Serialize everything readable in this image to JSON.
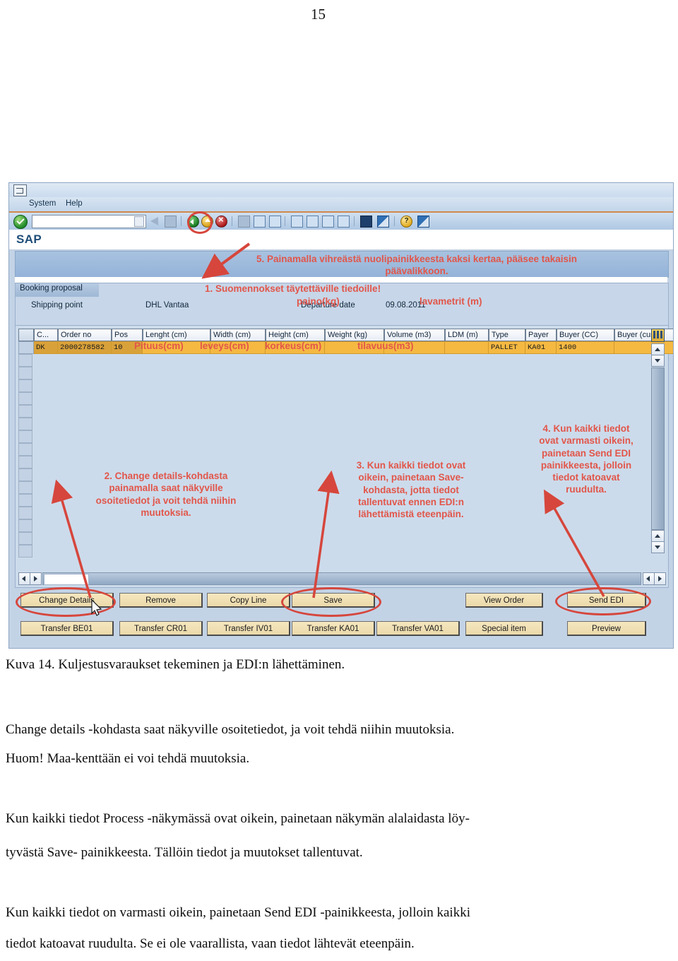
{
  "document": {
    "page_number": "15",
    "caption": "Kuva 14. Kuljestusvaraukset tekeminen ja EDI:n lähettäminen.",
    "paragraphs": [
      "Change details -kohdasta saat näkyville osoitetiedot, ja voit tehdä niihin muutoksia.",
      "Huom! Maa-kenttään ei voi tehdä muutoksia.",
      "Kun kaikki tiedot Process -näkymässä ovat oikein, painetaan näkymän alalaidasta löy-",
      "tyvästä Save- painikkeesta. Tällöin tiedot ja muutokset tallentuvat.",
      "Kun kaikki tiedot on varmasti oikein, painetaan Send EDI -painikkeesta, jolloin kaikki",
      "tiedot katoavat ruudulta. Se ei ole vaarallista, vaan tiedot lähtevät eteenpäin."
    ]
  },
  "sap": {
    "menubar": {
      "system": "System",
      "help": "Help"
    },
    "command_field": {
      "value": "",
      "placeholder": ""
    },
    "app_title": "SAP",
    "group": {
      "tab_label": "Booking proposal",
      "fields": [
        {
          "label": "Shipping point",
          "value": "DHL Vantaa"
        },
        {
          "label": "Departure date",
          "value": "09.08.2011"
        }
      ]
    },
    "grid": {
      "columns": [
        "C...",
        "Order no",
        "Pos",
        "Lenght (cm)",
        "Width (cm)",
        "Height (cm)",
        "Weight (kg)",
        "Volume (m3)",
        "LDM (m)",
        "Type",
        "Payer",
        "Buyer (CC)",
        "Buyer (cust)"
      ],
      "rows": [
        {
          "country": "DK",
          "order_no": "2000278582",
          "pos": "10",
          "length": "",
          "width": "",
          "height": "",
          "weight": "",
          "volume": "",
          "ldm": "",
          "type": "PALLET",
          "payer": "KA01",
          "buyer_cc": "1400",
          "buyer_cust": ""
        }
      ]
    },
    "buttons_row1": [
      "Change Details",
      "Remove",
      "Copy Line",
      "Save",
      "View Order",
      "Send EDI"
    ],
    "buttons_row2": [
      "Transfer BE01",
      "Transfer CR01",
      "Transfer IV01",
      "Transfer KA01",
      "Transfer VA01",
      "Special item",
      "Preview"
    ],
    "annotations": {
      "note5": "5. Painamalla vihreästä nuolipainikkeesta kaksi kertaa, pääsee takaisin  päävalikkoon.",
      "note1": "1. Suomennokset täytettäville tiedoille!",
      "note2": "2. Change details-kohdasta painamalla saat näkyville osoitetiedot ja voit tehdä niihin muutoksia.",
      "note3": "3. Kun kaikki tiedot ovat oikein, painetaan Save-kohdasta, jotta tiedot tallentuvat ennen EDI:n lähettämistä eteenpäin.",
      "note4": "4. Kun kaikki tiedot ovat varmasti oikein, painetaan Send EDI painikkeesta, jolloin tiedot katoavat ruudulta.",
      "field_labels": {
        "length_fi": "Pituus(cm)",
        "width_fi": "leveys(cm)",
        "height_fi": "korkeus(cm)",
        "weight_fi": "paino(kg)",
        "ldm_fi": "lavametrit (m)",
        "volume_fi": "tilavuus(m3)"
      }
    },
    "colors": {
      "annotation_red": "#e2564a",
      "highlight_row": "#f5b942",
      "window_bg": "#c3d3e6",
      "accent_orange": "#d2884a"
    }
  }
}
